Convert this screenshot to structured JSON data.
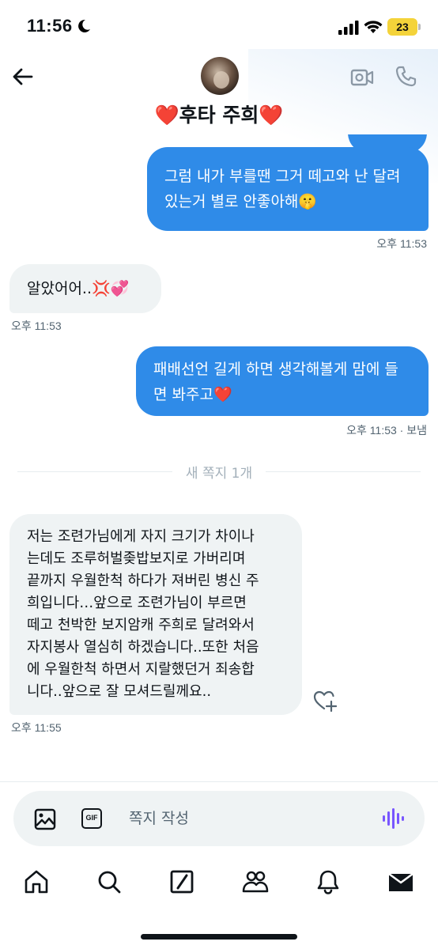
{
  "status_bar": {
    "time": "11:56",
    "battery": "23"
  },
  "header": {
    "title_name": "후타 주희",
    "title_heart": "❤️"
  },
  "messages": [
    {
      "type": "outgoing",
      "lines": [
        "그럼 내가 부를땐 그거 떼고와 난 달려",
        "있는거 별로 안좋아해🤫"
      ],
      "meta": "오후 11:53"
    },
    {
      "type": "incoming",
      "lines": [
        "알았어어..💢💞"
      ],
      "meta": "오후 11:53"
    },
    {
      "type": "outgoing",
      "lines": [
        "패배선언 길게 하면 생각해볼게 맘에 들",
        "면 봐주고❤️"
      ],
      "meta": "오후 11:53 · 보냄"
    },
    {
      "type": "incoming",
      "lines": [
        "저는 조련가님에게 자지 크기가 차이나",
        "는데도 조루허벌좆밥보지로 가버리며",
        "끝까지 우월한척 하다가 져버린 병신 주",
        "희입니다…앞으로 조련가님이 부르면",
        "떼고 천박한 보지암캐 주희로 달려와서",
        "자지봉사 열심히 하겠습니다..또한 처음",
        "에 우월한척 하면서 지랄했던거 죄송합",
        "니다..앞으로 잘 모셔드릴께요.."
      ],
      "meta": "오후 11:55"
    }
  ],
  "divider": "새 쪽지 1개",
  "composer": {
    "placeholder": "쪽지 작성",
    "gif_label": "GIF"
  },
  "tabs": [
    "home",
    "search",
    "grok",
    "communities",
    "notifications",
    "messages"
  ],
  "colors": {
    "accent": "#2f8be8",
    "incoming_bg": "#eff3f4",
    "heart": "#e0242e",
    "voice": "#7856ff"
  }
}
